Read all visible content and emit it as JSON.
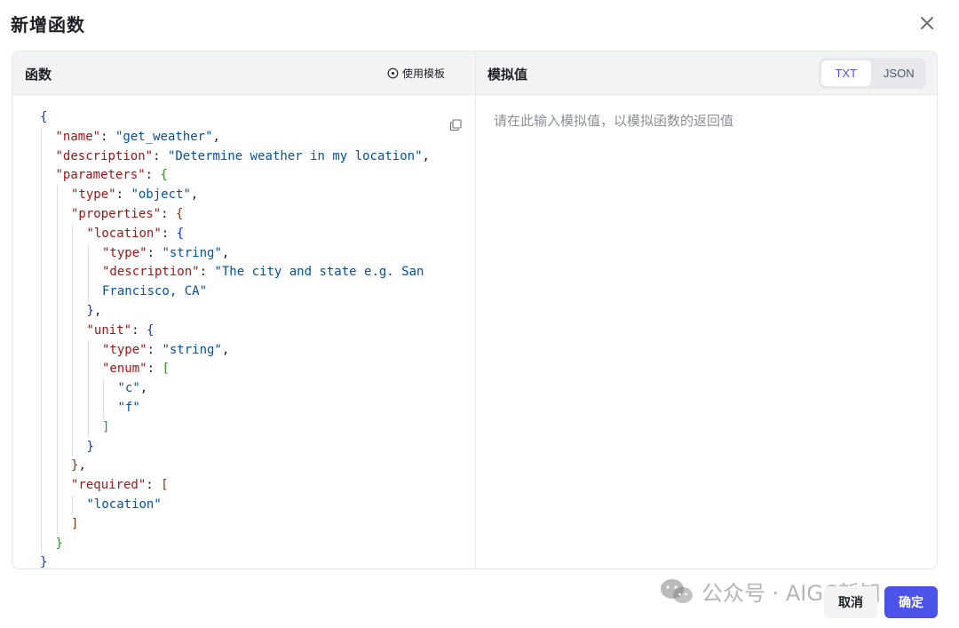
{
  "dialog": {
    "title": "新增函数",
    "close_icon": "close-icon"
  },
  "left_panel": {
    "title": "函数",
    "template_button": {
      "icon": "circle-dot-icon",
      "label": "使用模板"
    },
    "copy_icon": "copy-icon",
    "code_lines": [
      [
        [
          "b1",
          "{"
        ]
      ],
      [
        [
          "k",
          "\"name\""
        ],
        [
          "p",
          ": "
        ],
        [
          "s",
          "\"get_weather\""
        ],
        [
          "p",
          ","
        ]
      ],
      [
        [
          "k",
          "\"description\""
        ],
        [
          "p",
          ": "
        ],
        [
          "s",
          "\"Determine weather in my location\""
        ],
        [
          "p",
          ","
        ]
      ],
      [
        [
          "k",
          "\"parameters\""
        ],
        [
          "p",
          ": "
        ],
        [
          "b2",
          "{"
        ]
      ],
      [
        [
          "k",
          "\"type\""
        ],
        [
          "p",
          ": "
        ],
        [
          "s",
          "\"object\""
        ],
        [
          "p",
          ","
        ]
      ],
      [
        [
          "k",
          "\"properties\""
        ],
        [
          "p",
          ": "
        ],
        [
          "b3",
          "{"
        ]
      ],
      [
        [
          "k",
          "\"location\""
        ],
        [
          "p",
          ": "
        ],
        [
          "b1",
          "{"
        ]
      ],
      [
        [
          "k",
          "\"type\""
        ],
        [
          "p",
          ": "
        ],
        [
          "s",
          "\"string\""
        ],
        [
          "p",
          ","
        ]
      ],
      [
        [
          "k",
          "\"description\""
        ],
        [
          "p",
          ": "
        ],
        [
          "s",
          "\"The city and state e.g. San"
        ]
      ],
      [
        [
          "s",
          "Francisco, CA\""
        ]
      ],
      [
        [
          "b1",
          "}"
        ],
        [
          "p",
          ","
        ]
      ],
      [
        [
          "k",
          "\"unit\""
        ],
        [
          "p",
          ": "
        ],
        [
          "b1",
          "{"
        ]
      ],
      [
        [
          "k",
          "\"type\""
        ],
        [
          "p",
          ": "
        ],
        [
          "s",
          "\"string\""
        ],
        [
          "p",
          ","
        ]
      ],
      [
        [
          "k",
          "\"enum\""
        ],
        [
          "p",
          ": "
        ],
        [
          "b2",
          "["
        ]
      ],
      [
        [
          "s",
          "\"c\""
        ],
        [
          "p",
          ","
        ]
      ],
      [
        [
          "s",
          "\"f\""
        ]
      ],
      [
        [
          "b2",
          "]"
        ]
      ],
      [
        [
          "b1",
          "}"
        ]
      ],
      [
        [
          "b3",
          "}"
        ],
        [
          "p",
          ","
        ]
      ],
      [
        [
          "k",
          "\"required\""
        ],
        [
          "p",
          ": "
        ],
        [
          "b3",
          "["
        ]
      ],
      [
        [
          "s",
          "\"location\""
        ]
      ],
      [
        [
          "b3",
          "]"
        ]
      ],
      [
        [
          "b2",
          "}"
        ]
      ],
      [
        [
          "b1",
          "}"
        ]
      ]
    ]
  },
  "right_panel": {
    "title": "模拟值",
    "tabs": [
      {
        "label": "TXT",
        "active": true
      },
      {
        "label": "JSON",
        "active": false
      }
    ],
    "placeholder": "请在此输入模拟值，以模拟函数的返回值"
  },
  "footer": {
    "cancel_label": "取消",
    "confirm_label": "确定"
  },
  "watermark": {
    "text": "公众号 · AIGC新知",
    "icon": "wechat-icon"
  },
  "colors": {
    "accent": "#4d53e8",
    "key": "#a31515",
    "string": "#0451a5",
    "brace_level1": "#0431fa",
    "brace_level2": "#319331",
    "brace_level3": "#7b3814"
  }
}
